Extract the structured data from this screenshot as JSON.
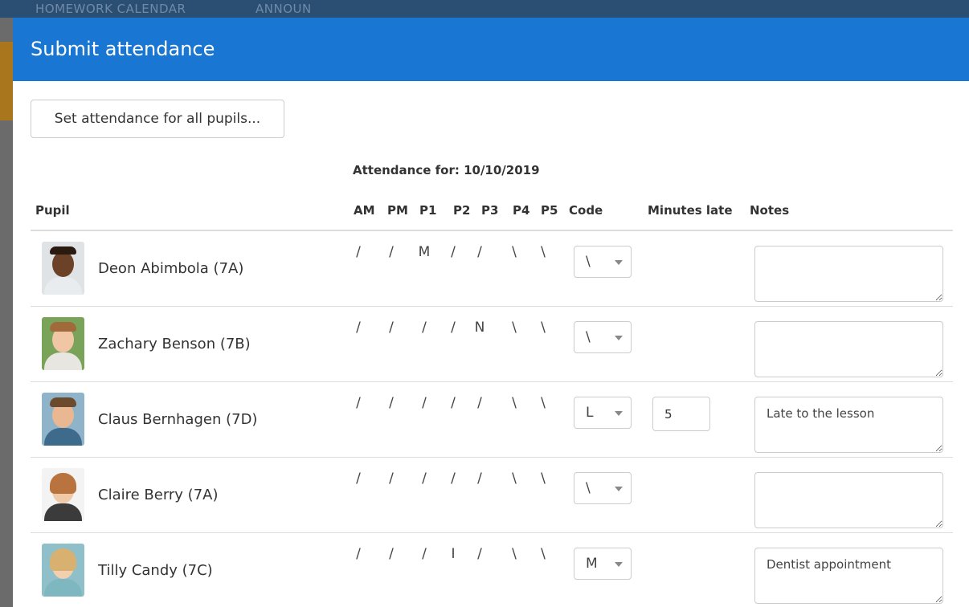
{
  "background": {
    "nav_items": [
      "HOMEWORK CALENDAR",
      "ANNOUN"
    ]
  },
  "modal": {
    "title": "Submit attendance",
    "set_all_label": "Set attendance for all pupils...",
    "attendance_for": "Attendance for: 10/10/2019",
    "columns": {
      "pupil": "Pupil",
      "am": "AM",
      "pm": "PM",
      "p1": "P1",
      "p2": "P2",
      "p3": "P3",
      "p4": "P4",
      "p5": "P5",
      "code": "Code",
      "minutes_late": "Minutes late",
      "notes": "Notes"
    },
    "pupils": [
      {
        "name": "Deon Abimbola (7A)",
        "marks": [
          "/",
          "/",
          "M",
          "/",
          "/",
          "\\",
          "\\"
        ],
        "code": "\\",
        "minutes_late": "",
        "notes": ""
      },
      {
        "name": "Zachary Benson (7B)",
        "marks": [
          "/",
          "/",
          "/",
          "/",
          "N",
          "\\",
          "\\"
        ],
        "code": "\\",
        "minutes_late": "",
        "notes": ""
      },
      {
        "name": "Claus Bernhagen (7D)",
        "marks": [
          "/",
          "/",
          "/",
          "/",
          "/",
          "\\",
          "\\"
        ],
        "code": "L",
        "minutes_late": "5",
        "notes": "Late to the lesson"
      },
      {
        "name": "Claire Berry (7A)",
        "marks": [
          "/",
          "/",
          "/",
          "/",
          "/",
          "\\",
          "\\"
        ],
        "code": "\\",
        "minutes_late": "",
        "notes": ""
      },
      {
        "name": "Tilly Candy (7C)",
        "marks": [
          "/",
          "/",
          "/",
          "I",
          "/",
          "\\",
          "\\"
        ],
        "code": "M",
        "minutes_late": "",
        "notes": "Dentist appointment"
      }
    ]
  },
  "colors": {
    "header": "#1976d2",
    "header_text": "#ffffff",
    "divider": "#dddddd"
  }
}
